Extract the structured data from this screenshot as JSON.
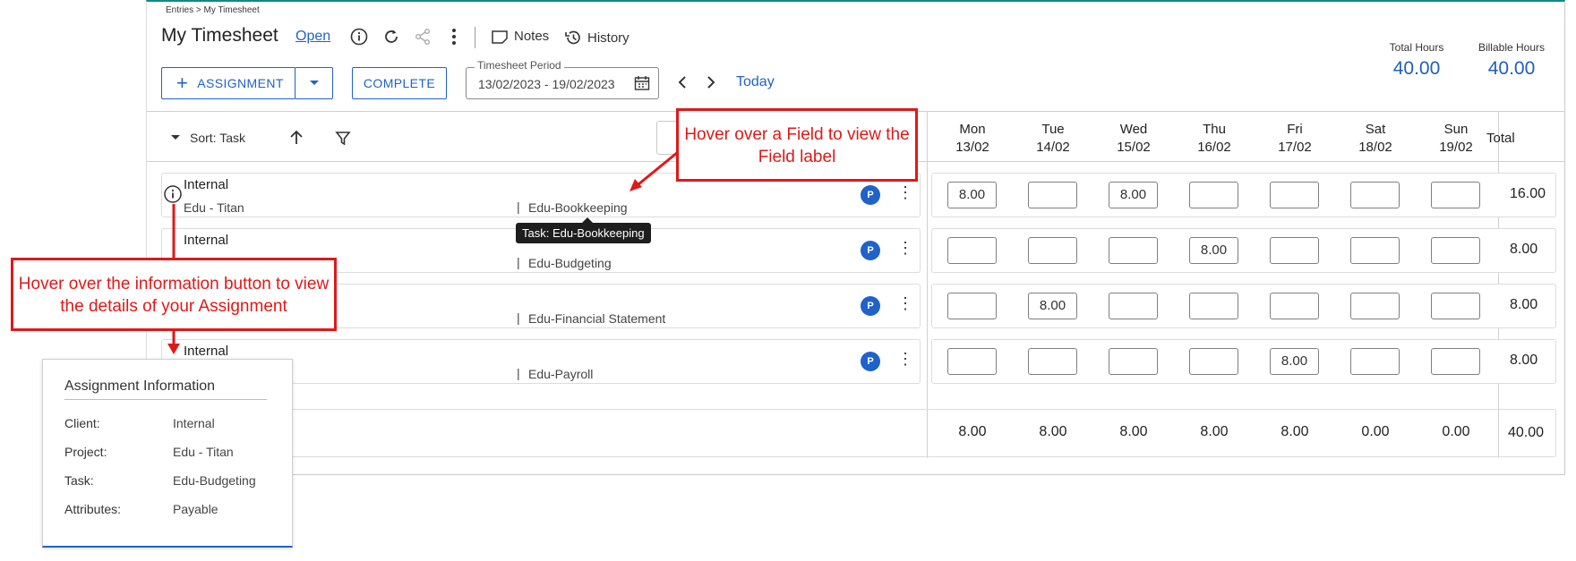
{
  "breadcrumb": "Entries > My Timesheet",
  "title": "My Timesheet",
  "status_link": "Open",
  "header_buttons": {
    "notes": "Notes",
    "history": "History"
  },
  "totals": {
    "total_label": "Total Hours",
    "total_value": "40.00",
    "billable_label": "Billable Hours",
    "billable_value": "40.00"
  },
  "toolbar": {
    "assignment": "ASSIGNMENT",
    "complete": "COMPLETE",
    "period_label": "Timesheet Period",
    "period_value": "13/02/2023 - 19/02/2023",
    "today": "Today"
  },
  "sort": {
    "label": "Sort: Task"
  },
  "days": [
    {
      "name": "Mon",
      "date": "13/02"
    },
    {
      "name": "Tue",
      "date": "14/02"
    },
    {
      "name": "Wed",
      "date": "15/02"
    },
    {
      "name": "Thu",
      "date": "16/02"
    },
    {
      "name": "Fri",
      "date": "17/02"
    },
    {
      "name": "Sat",
      "date": "18/02"
    },
    {
      "name": "Sun",
      "date": "19/02"
    }
  ],
  "total_header": "Total",
  "rows": [
    {
      "client": "Internal",
      "project": "Edu - Titan",
      "task": "Edu-Bookkeeping",
      "badge": "P",
      "hours": [
        "8.00",
        "",
        "8.00",
        "",
        "",
        "",
        ""
      ],
      "total": "16.00"
    },
    {
      "client": "Internal",
      "project": "",
      "task": "Edu-Budgeting",
      "badge": "P",
      "hours": [
        "",
        "",
        "",
        "8.00",
        "",
        "",
        ""
      ],
      "total": "8.00"
    },
    {
      "client": "",
      "project": "",
      "task": "Edu-Financial Statement",
      "badge": "P",
      "hours": [
        "",
        "8.00",
        "",
        "",
        "",
        "",
        ""
      ],
      "total": "8.00"
    },
    {
      "client": "Internal",
      "project": "",
      "task": "Edu-Payroll",
      "badge": "P",
      "hours": [
        "",
        "",
        "",
        "",
        "8.00",
        "",
        ""
      ],
      "total": "8.00"
    }
  ],
  "day_totals": [
    "8.00",
    "8.00",
    "8.00",
    "8.00",
    "8.00",
    "0.00",
    "0.00"
  ],
  "grand_total": "40.00",
  "tooltip": "Task: Edu-Bookkeeping",
  "callouts": {
    "field": "Hover over a Field to view the Field label",
    "info": "Hover over the information button to view the details of your Assignment"
  },
  "assignment_info": {
    "title": "Assignment Information",
    "fields": [
      {
        "label": "Client:",
        "value": "Internal"
      },
      {
        "label": "Project:",
        "value": "Edu - Titan"
      },
      {
        "label": "Task:",
        "value": "Edu-Budgeting"
      },
      {
        "label": "Attributes:",
        "value": "Payable"
      }
    ]
  },
  "colors": {
    "accent": "#1f62c9",
    "callout": "#e01818",
    "frame_top": "#0e8a8a"
  }
}
